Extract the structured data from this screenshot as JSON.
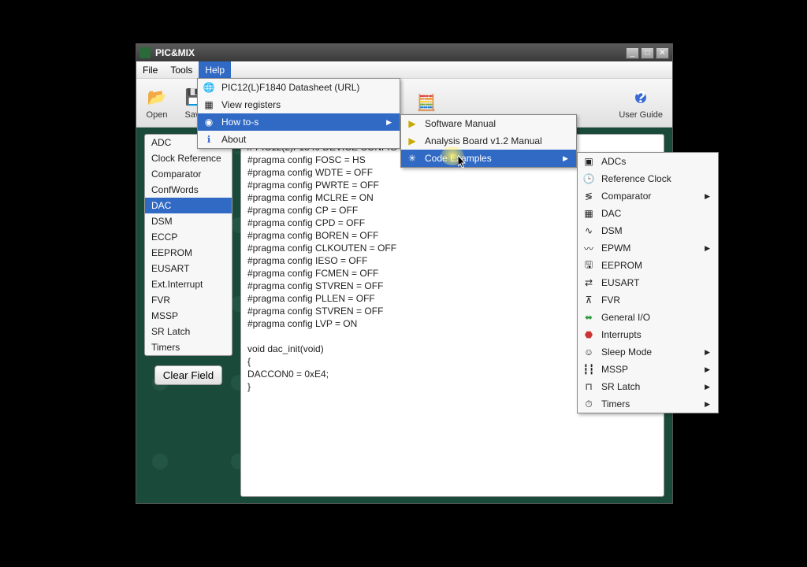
{
  "titlebar": {
    "title": "PIC&MIX"
  },
  "menubar": {
    "items": [
      "File",
      "Tools",
      "Help"
    ],
    "active_index": 2
  },
  "toolbar": {
    "open": "Open",
    "save": "Save",
    "userguide": "User Guide"
  },
  "sidebar": {
    "items": [
      "ADC",
      "Clock Reference",
      "Comparator",
      "ConfWords",
      "DAC",
      "DSM",
      "ECCP",
      "EEPROM",
      "EUSART",
      "Ext.Interrupt",
      "FVR",
      "MSSP",
      "SR Latch",
      "Timers"
    ],
    "selected_index": 4,
    "clear_label": "Clear Field"
  },
  "editor": {
    "text": "// PIC12(L)F1840 DEVICE CONFIG\n#pragma config FOSC = HS\n#pragma config WDTE = OFF\n#pragma config PWRTE = OFF\n#pragma config MCLRE = ON\n#pragma config CP = OFF\n#pragma config CPD = OFF\n#pragma config BOREN = OFF\n#pragma config CLKOUTEN = OFF\n#pragma config IESO = OFF\n#pragma config FCMEN = OFF\n#pragma config STVREN = OFF\n#pragma config PLLEN = OFF\n#pragma config STVREN = OFF\n#pragma config LVP = ON\n\nvoid dac_init(void)\n{\nDACCON0 = 0xE4;\n}"
  },
  "help_menu": {
    "items": [
      {
        "icon": "globe",
        "label": "PIC12(L)F1840 Datasheet (URL)"
      },
      {
        "icon": "table",
        "label": "View registers"
      },
      {
        "icon": "ring",
        "label": "How to-s",
        "submenu": true,
        "active": true
      },
      {
        "icon": "info",
        "label": "About"
      }
    ]
  },
  "howto_menu": {
    "items": [
      {
        "icon": "play",
        "label": "Software Manual"
      },
      {
        "icon": "play",
        "label": "Analysis Board v1.2 Manual"
      },
      {
        "icon": "gear",
        "label": "Code Examples",
        "submenu": true,
        "active": true,
        "highlight": true
      }
    ]
  },
  "examples_menu": {
    "items": [
      {
        "icon": "chip",
        "label": "ADCs"
      },
      {
        "icon": "clock",
        "label": "Reference Clock"
      },
      {
        "icon": "cmp",
        "label": "Comparator",
        "submenu": true
      },
      {
        "icon": "dac",
        "label": "DAC"
      },
      {
        "icon": "dsm",
        "label": "DSM"
      },
      {
        "icon": "wave",
        "label": "EPWM",
        "submenu": true
      },
      {
        "icon": "mem",
        "label": "EEPROM"
      },
      {
        "icon": "uart",
        "label": "EUSART"
      },
      {
        "icon": "fvr",
        "label": "FVR"
      },
      {
        "icon": "io",
        "label": "General I/O"
      },
      {
        "icon": "stop",
        "label": "Interrupts"
      },
      {
        "icon": "face",
        "label": "Sleep Mode",
        "submenu": true
      },
      {
        "icon": "mssp",
        "label": "MSSP",
        "submenu": true
      },
      {
        "icon": "sr",
        "label": "SR Latch",
        "submenu": true
      },
      {
        "icon": "timer",
        "label": "Timers",
        "submenu": true
      }
    ]
  }
}
